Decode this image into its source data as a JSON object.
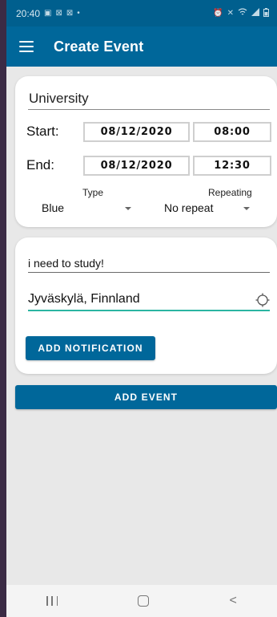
{
  "status_bar": {
    "time": "20:40",
    "icons_left": [
      "image-icon",
      "mail-icon",
      "mail-icon",
      "dot-icon"
    ],
    "icons_right": [
      "alarm-icon",
      "mute-icon",
      "wifi-icon",
      "signal-icon",
      "battery-icon"
    ]
  },
  "app_bar": {
    "title": "Create Event"
  },
  "event": {
    "title": "University",
    "start_label": "Start:",
    "start_date": "08/12/2020",
    "start_time": "08:00",
    "end_label": "End:",
    "end_date": "08/12/2020",
    "end_time": "12:30",
    "type_label": "Type",
    "type_value": "Blue",
    "repeat_label": "Repeating",
    "repeat_value": "No repeat"
  },
  "details": {
    "description": "i need to study!",
    "location": "Jyväskylä, Finnland",
    "add_notification_label": "ADD NOTIFICATION"
  },
  "add_event_label": "ADD EVENT",
  "colors": {
    "primary": "#00679a",
    "status_bar": "#005f8e",
    "accent": "#2bb5a2",
    "background": "#e8e8e8"
  }
}
